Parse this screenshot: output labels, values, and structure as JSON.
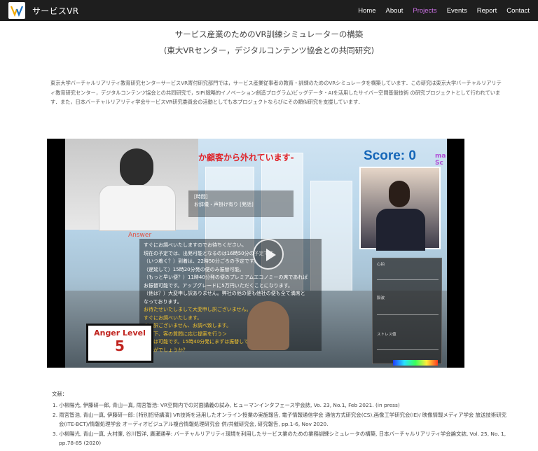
{
  "nav": {
    "brand": "サービスVR",
    "items": [
      {
        "label": "Home",
        "active": false
      },
      {
        "label": "About",
        "active": false
      },
      {
        "label": "Projects",
        "active": true
      },
      {
        "label": "Events",
        "active": false
      },
      {
        "label": "Report",
        "active": false
      },
      {
        "label": "Contact",
        "active": false
      }
    ],
    "active_color": "#c86fe0"
  },
  "page": {
    "title": "サービス産業のためのVR訓練シミュレーターの構築",
    "subtitle": "(東大VRセンター，デジタルコンテンツ協会との共同研究)",
    "intro": "東京大学バーチャルリアリティ教育研究センターサービスVR寄付研究部門では，サービス産業従事者の教育・訓練のためのVRシミュレータを構築しています．この研究は東京大学バーチャルリアリティ教育研究センター，デジタルコンテンツ協会との共同研究で，SIP(戦略的イノベーション創造プログラム)ビッグデータ・AIを活用したサイバー空間基盤技術 の研究プロジェクトとして行われています．また，日本バーチャルリアリティ学会サービスVR研究委員会の活動としても本プロジェクトならびにその類似研究を支援しています．"
  },
  "video": {
    "banner_text": "か顧客から外れています-",
    "score_label": "Score: 0",
    "side_text": [
      "ma",
      "Sc"
    ],
    "prompt_lines": [
      "[時間]",
      "お辞儀・声掛け有り [発話]"
    ],
    "answer_label": "Answer",
    "answer_lines_white": [
      "すぐにお調べいたしますのでお待ちください。",
      "現在の予定では、出発可能となるのは16時50分の予定です。",
      "（いつ着く？）到着は、22時50分ごろの予定です。",
      "（遅延して）15時20分発の便のみ振替可能。",
      "（もっと早い便？）11時40分発の便のプレミアムエコノミーの席であれば",
      "お振替可能です。アップグレードに5万円いただくことになります。",
      "（他は？）大変申し訳ありません。弊社の他の便も他社の便も全て満席と",
      "なっております。"
    ],
    "answer_lines_yellow": [
      "お待たせいたしまして大変申し訳ございません。",
      "すぐにお調べいたします。",
      "申し訳ございません、お調べ致します。",
      "＜以下、客の質問に応じ提案を行う＞",
      "振替は可能です。15時40分発にまずは振替しては",
      "いかがでしょうか？"
    ],
    "anger_label": "Anger Level",
    "anger_value": "5",
    "graph_labels": [
      "心拍",
      "脈波",
      "ストレス値"
    ]
  },
  "references": {
    "title": "文献：",
    "items": [
      "1. 小柳陽光, 伊藤研一郎, 青山一真, 雨宮智浩: VR空間内での対面講義の試み, ヒューマンインタフェース学会誌, Vo. 23, No.1, Feb 2021. (in press)",
      "2. 雨宮智浩, 青山一真, 伊藤研一郎: [特別招待講演] VR技術を活用したオンライン授業の実施報告, 電子情報通信学会 通信方式研究会(CS),画像工学研究会(IE)/ 映像情報メディア学会 放送技術研究会(ITE-BCT)/情報処理学会 オーディオビジュアル複合情報処理研究会 併/共催研究会, 研究報告, pp.1-6, Nov 2020.",
      "3. 小柳陽光, 青山一真, 大村廉, 谷川智洋, 廣瀬通孝: バーチャルリアリティ環境を利用したサービス業のための業務訓練シミュレータの構築, 日本バーチャルリアリティ学会論文誌, Vol. 25, No. 1, pp.78-85 (2020)"
    ]
  }
}
